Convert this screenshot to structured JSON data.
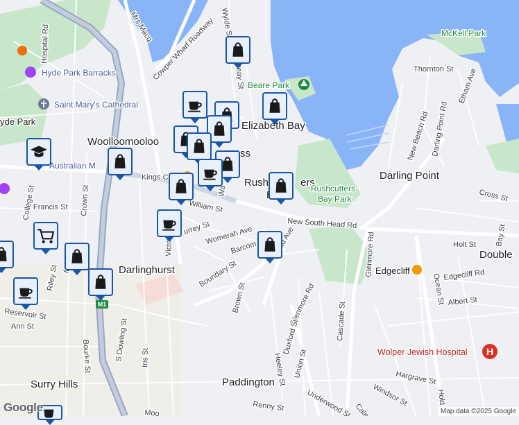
{
  "labels": {
    "mcelhone": "Mrs Macq",
    "wylde": "Wylde St",
    "mckell_park": "McKell Park",
    "hospital_rd": "Hospital Rd",
    "hyde_park_barracks": "Hyde Park Barracks",
    "cowper_wharf": "Cowper Wharf Roadway",
    "thornton": "Thornton St",
    "beare_park": "Beare Park",
    "st_marys": "Saint Mary's Cathedral",
    "hyde_park": "yde Park",
    "ethan": "Etham Ave",
    "macleay": "cleay St",
    "elizabeth_bay": "Elizabeth Bay",
    "new_beach": "New Beach Rd",
    "darling_point_rd": "Darling Point Rd",
    "woolloomooloo": "Woolloomooloo",
    "potts_point_frag": "ss",
    "australian_museum": "Australian M",
    "kings_cross": "Kings Cro",
    "darling_point": "Darling Point",
    "rushcutters": "Rush",
    "rushcutters_tail": "ers",
    "rushcutters_bay_frag": "B",
    "college": "College St",
    "crown": "Crown St",
    "francis": "Francis St",
    "william": "William St",
    "victoria_frag": "Wa",
    "rushcutters_park_1": "Rushcutters",
    "rushcutters_park_2": "Bay Park",
    "cross_st": "Cross St",
    "victoria": "Victo",
    "surrey": "urrey St",
    "womerah": "Womerah Ave",
    "barcom": "Barcom Ave",
    "new_south_head": "New South Head Rd",
    "neild": "Neild Ave",
    "holt": "Holt St",
    "double_bay": "Double",
    "bay_st": "Bay St",
    "darlinghurst": "Darlinghurst",
    "riley": "Riley St",
    "boundary": "Boundary St",
    "glenmore_rd": "Glenmore Rd",
    "edgecliff": "Edgecliff",
    "edgecliff_rd": "Edgecliff Rd",
    "ocean": "Ocean St",
    "albert": "Albert St",
    "reservoir": "Reservoir St",
    "m1": "M1",
    "brown": "Brown St",
    "glenmore_rd2": "Glenmore Rd",
    "cascade": "Cascade St",
    "ann": "Ann St",
    "bourke": "Bourke St",
    "s_dowling": "S Dowling St",
    "iris": "Iris St",
    "heeley": "Heeley St",
    "duxford": "Duxford St",
    "wolper": "Wolper Jewish Hospital",
    "hargrave": "Hargrave St",
    "union": "Union St",
    "windsor": "Windsor St",
    "surry_hills": "Surry Hills",
    "paddington": "Paddington",
    "underwood": "Underwood St",
    "renny": "Renny St",
    "moore_frag": "Moo",
    "cale": "Cale",
    "hold": "Hold",
    "ford": "ford"
  },
  "icons": {
    "shopping": "shopping-bag-icon",
    "cafe": "coffee-cup-icon",
    "school": "graduation-cap-icon",
    "restaurant": "cutlery-icon"
  },
  "colors": {
    "water": "#8ab4f8",
    "park": "#c8e6c9",
    "major_road": "#ffffff",
    "motorway": "#aab6c8",
    "pin_border": "#1a56a6",
    "hospital": "#d93025"
  },
  "branding": {
    "logo": "Google"
  },
  "attribution": "Map data ©2025 Google"
}
